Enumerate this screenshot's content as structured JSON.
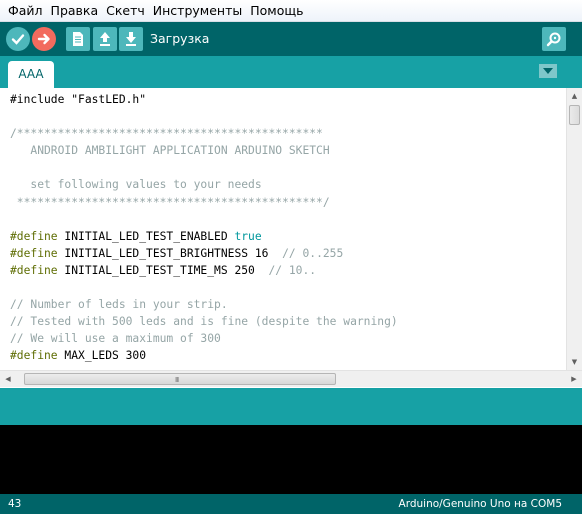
{
  "menu": [
    "Файл",
    "Правка",
    "Скетч",
    "Инструменты",
    "Помощь"
  ],
  "toolbar": {
    "status_label": "Загрузка",
    "buttons": [
      "verify-icon",
      "upload-icon",
      "new-icon",
      "open-icon",
      "save-icon",
      "serial-monitor-icon"
    ]
  },
  "tabs": [
    {
      "label": "AAA"
    }
  ],
  "editor": {
    "lines": [
      [
        {
          "t": "#include \"FastLED.h\"",
          "c": ""
        }
      ],
      [
        {
          "t": "",
          "c": ""
        }
      ],
      [
        {
          "t": "/*********************************************",
          "c": "cm"
        }
      ],
      [
        {
          "t": "   ANDROID AMBILIGHT APPLICATION ARDUINO SKETCH",
          "c": "cm"
        }
      ],
      [
        {
          "t": "",
          "c": ""
        }
      ],
      [
        {
          "t": "   set following values to your needs",
          "c": "cm"
        }
      ],
      [
        {
          "t": " *********************************************/",
          "c": "cm"
        }
      ],
      [
        {
          "t": "",
          "c": ""
        }
      ],
      [
        {
          "t": "#define",
          "c": "kw"
        },
        {
          "t": " INITIAL_LED_TEST_ENABLED ",
          "c": ""
        },
        {
          "t": "true",
          "c": "kw2"
        }
      ],
      [
        {
          "t": "#define",
          "c": "kw"
        },
        {
          "t": " INITIAL_LED_TEST_BRIGHTNESS 16  ",
          "c": ""
        },
        {
          "t": "// 0..255",
          "c": "cm"
        }
      ],
      [
        {
          "t": "#define",
          "c": "kw"
        },
        {
          "t": " INITIAL_LED_TEST_TIME_MS 250  ",
          "c": ""
        },
        {
          "t": "// 10..",
          "c": "cm"
        }
      ],
      [
        {
          "t": "",
          "c": ""
        }
      ],
      [
        {
          "t": "// Number of leds in your strip.",
          "c": "cm"
        }
      ],
      [
        {
          "t": "// Tested with 500 leds and is fine (despite the warning)",
          "c": "cm"
        }
      ],
      [
        {
          "t": "// We will use a maximum of 300",
          "c": "cm"
        }
      ],
      [
        {
          "t": "#define",
          "c": "kw"
        },
        {
          "t": " MAX_LEDS 300",
          "c": ""
        }
      ]
    ]
  },
  "hscroll": {
    "grip": "III"
  },
  "status": {
    "line_number": "43",
    "board": "Arduino/Genuino Uno на COM5"
  },
  "colors": {
    "toolbar": "#006468",
    "tabbar": "#17a1a5",
    "upload": "#f26b5e",
    "button": "#4db7bb",
    "console": "#000000"
  }
}
